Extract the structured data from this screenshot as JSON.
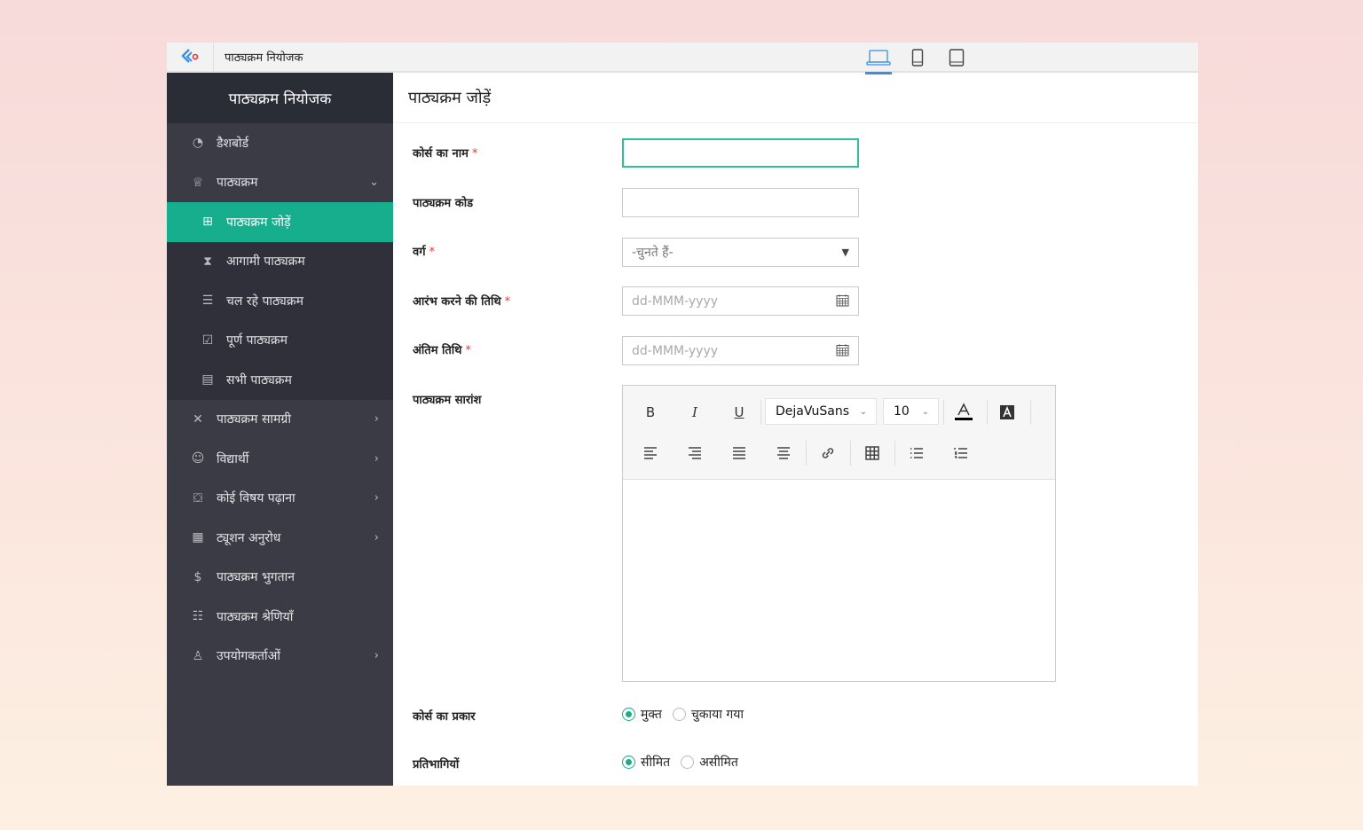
{
  "app": {
    "title": "पाठ्यक्रम नियोजक",
    "accent": "#17ae8e"
  },
  "devices": [
    {
      "icon": "laptop-icon",
      "active": true
    },
    {
      "icon": "mobile-icon"
    },
    {
      "icon": "tablet-icon"
    }
  ],
  "sidebar": {
    "title": "पाठ्यक्रम नियोजक",
    "items": [
      {
        "label": "डैशबोर्ड",
        "icon": "dashboard-icon"
      },
      {
        "label": "पाठ्यक्रम",
        "icon": "course-icon",
        "expanded": true
      },
      {
        "label": "पाठ्यक्रम जोड़ें",
        "icon": "add-icon",
        "active": true,
        "sub": true
      },
      {
        "label": "आगामी पाठ्यक्रम",
        "icon": "hourglass-icon",
        "sub": true
      },
      {
        "label": "चल रहे पाठ्यक्रम",
        "icon": "list-icon",
        "sub": true
      },
      {
        "label": "पूर्ण पाठ्यक्रम",
        "icon": "clipboard-check-icon",
        "sub": true
      },
      {
        "label": "सभी पाठ्यक्रम",
        "icon": "all-courses-icon",
        "sub": true
      },
      {
        "label": "पाठ्यक्रम सामग्री",
        "icon": "tools-icon",
        "chevron": true
      },
      {
        "label": "विद्यार्थी",
        "icon": "user-icon",
        "chevron": true
      },
      {
        "label": "कोई विषय पढ़ाना",
        "icon": "teacher-icon",
        "chevron": true
      },
      {
        "label": "ट्यूशन अनुरोध",
        "icon": "request-icon",
        "chevron": true
      },
      {
        "label": "पाठ्यक्रम भुगतान",
        "icon": "payment-icon"
      },
      {
        "label": "पाठ्यक्रम श्रेणियाँ",
        "icon": "sliders-icon"
      },
      {
        "label": "उपयोगकर्ताओं",
        "icon": "users-icon",
        "chevron": true
      }
    ]
  },
  "form": {
    "title": "पाठ्यक्रम जोड़ें",
    "course_name": {
      "label": "कोर्स का नाम",
      "value": ""
    },
    "course_code": {
      "label": "पाठ्यक्रम कोड",
      "value": ""
    },
    "category": {
      "label": "वर्ग",
      "placeholder": "-चुनते हैं-"
    },
    "start_date": {
      "label": "आरंभ करने की तिथि",
      "placeholder": "dd-MMM-yyyy"
    },
    "end_date": {
      "label": "अंतिम तिथि",
      "placeholder": "dd-MMM-yyyy"
    },
    "summary": {
      "label": "पाठ्यक्रम सारांश",
      "font": "DejaVuSans",
      "size": "10",
      "bold": "B",
      "italic": "I",
      "underline": "U"
    },
    "course_type": {
      "label": "कोर्स का प्रकार",
      "options": [
        "मुक्त",
        "चुकाया गया"
      ],
      "selected": 0
    },
    "participants": {
      "label": "प्रतिभागियों",
      "options": [
        "सीमित",
        "असीमित"
      ],
      "selected": 0
    },
    "required_mark": "*"
  }
}
